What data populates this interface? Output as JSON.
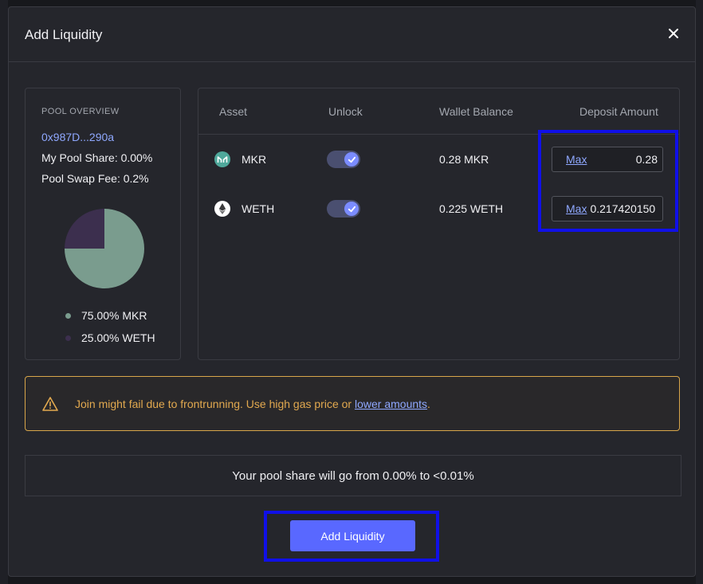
{
  "modal": {
    "title": "Add Liquidity"
  },
  "pool_overview": {
    "heading": "POOL OVERVIEW",
    "address": "0x987D...290a",
    "my_pool_share": "My Pool Share: 0.00%",
    "pool_swap_fee": "Pool Swap Fee: 0.2%",
    "weights": [
      {
        "label": "75.00% MKR",
        "percent": 75,
        "color": "#7a9c8e"
      },
      {
        "label": "25.00% WETH",
        "percent": 25,
        "color": "#3c2f4e"
      }
    ]
  },
  "assets_table": {
    "headers": [
      "Asset",
      "Unlock",
      "Wallet Balance",
      "Deposit Amount"
    ],
    "rows": [
      {
        "icon": "mkr-icon",
        "asset": "MKR",
        "unlocked": true,
        "wallet_balance": "0.28 MKR",
        "max_label": "Max",
        "deposit_value": "0.28"
      },
      {
        "icon": "eth-icon",
        "asset": "WETH",
        "unlocked": true,
        "wallet_balance": "0.225 WETH",
        "max_label": "Max",
        "deposit_value": "0.217420150"
      }
    ]
  },
  "warning": {
    "icon": "warning-triangle-icon",
    "text": "Join might fail due to frontrunning. Use high gas price or ",
    "link_text": "lower amounts",
    "suffix": "."
  },
  "pool_share_summary": "Your pool share will go from 0.00% to <0.01%",
  "submit_label": "Add Liquidity",
  "colors": {
    "accent": "#5968ff",
    "link": "#8fa8ff",
    "warning": "#e2a94f",
    "highlight": "#1010e8"
  }
}
